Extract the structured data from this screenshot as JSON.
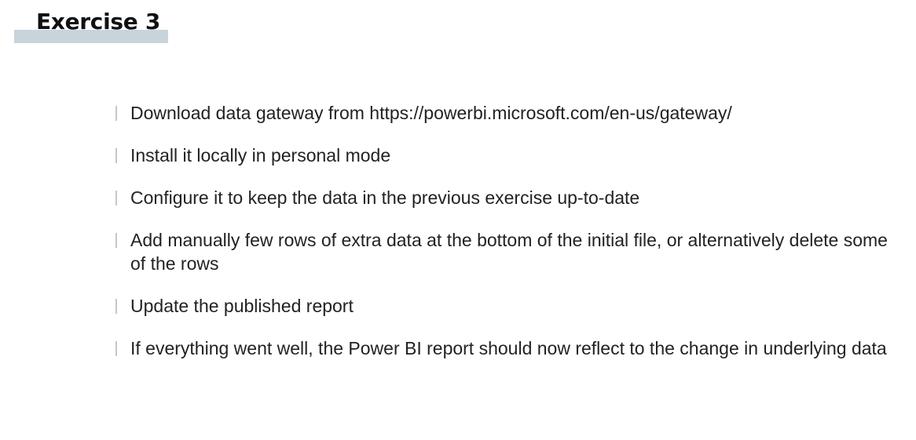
{
  "slide": {
    "title": "Exercise 3",
    "bullets": [
      "Download data gateway from https://powerbi.microsoft.com/en-us/gateway/",
      "Install it locally in personal mode",
      "Configure it to keep the data in the previous exercise up-to-date",
      "Add manually few rows of extra data at the bottom of the initial file, or alternatively delete some of the rows",
      "Update the published report",
      "If everything went well, the Power BI report should now reflect to the change in underlying data"
    ]
  }
}
